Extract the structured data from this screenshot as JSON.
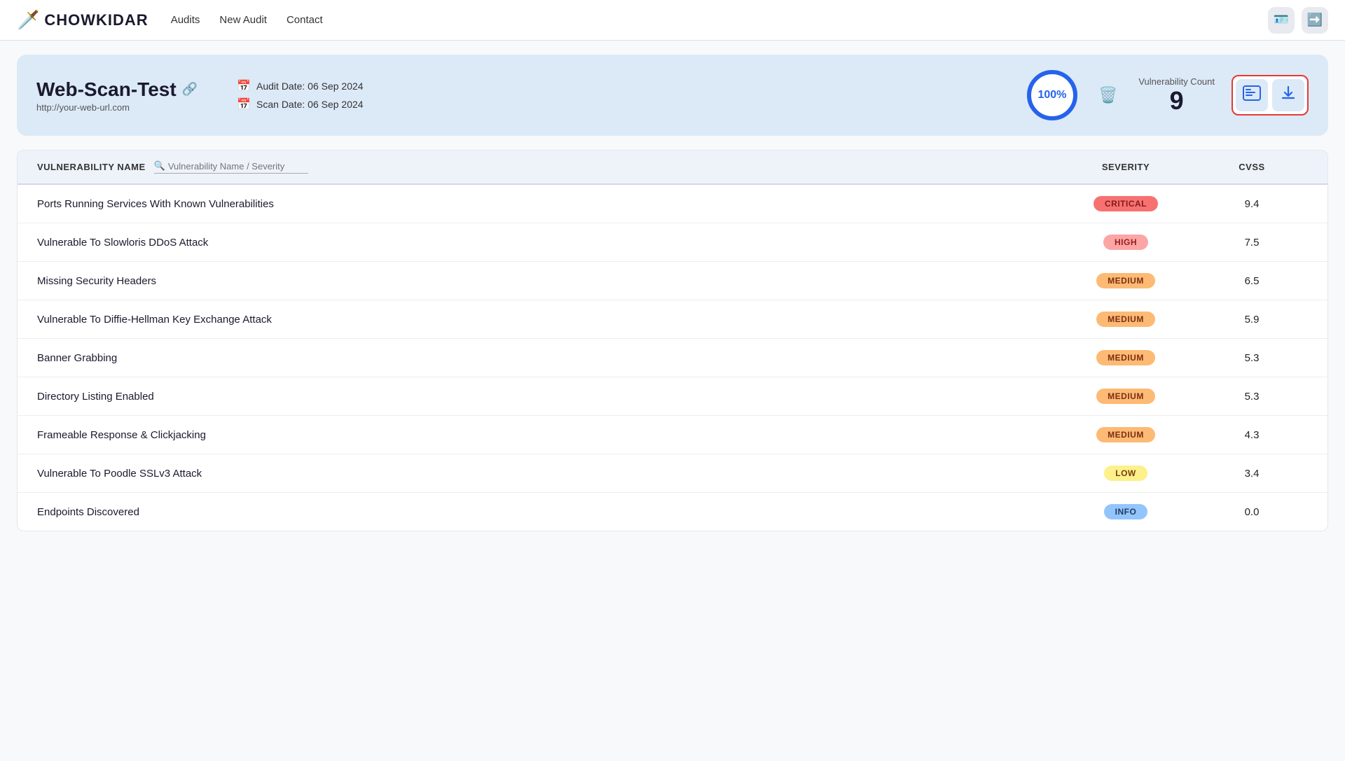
{
  "navbar": {
    "logo_text": "CHOWKIDAR",
    "links": [
      {
        "label": "Audits",
        "id": "audits"
      },
      {
        "label": "New Audit",
        "id": "new-audit"
      },
      {
        "label": "Contact",
        "id": "contact"
      }
    ],
    "icon_buttons": [
      {
        "id": "user-icon-btn",
        "icon": "👤"
      },
      {
        "id": "logout-icon-btn",
        "icon": "🚪"
      }
    ]
  },
  "header": {
    "title": "Web-Scan-Test",
    "url": "http://your-web-url.com",
    "audit_date_label": "Audit Date: 06 Sep 2024",
    "scan_date_label": "Scan Date: 06 Sep 2024",
    "progress": "100%",
    "vuln_count_label": "Vulnerability Count",
    "vuln_count": "9",
    "action_btn_1_icon": "🖥️",
    "action_btn_2_icon": "⬇️"
  },
  "table": {
    "columns": [
      {
        "id": "name",
        "label": "VULNERABILITY NAME"
      },
      {
        "id": "severity",
        "label": "SEVERITY"
      },
      {
        "id": "cvss",
        "label": "CVSS"
      }
    ],
    "search_placeholder": "Vulnerability Name / Severity",
    "rows": [
      {
        "name": "Ports Running Services With Known Vulnerabilities",
        "severity": "CRITICAL",
        "severity_class": "critical",
        "cvss": "9.4"
      },
      {
        "name": "Vulnerable To Slowloris DDoS Attack",
        "severity": "HIGH",
        "severity_class": "high",
        "cvss": "7.5"
      },
      {
        "name": "Missing Security Headers",
        "severity": "MEDIUM",
        "severity_class": "medium",
        "cvss": "6.5"
      },
      {
        "name": "Vulnerable To Diffie-Hellman Key Exchange Attack",
        "severity": "MEDIUM",
        "severity_class": "medium",
        "cvss": "5.9"
      },
      {
        "name": "Banner Grabbing",
        "severity": "MEDIUM",
        "severity_class": "medium",
        "cvss": "5.3"
      },
      {
        "name": "Directory Listing Enabled",
        "severity": "MEDIUM",
        "severity_class": "medium",
        "cvss": "5.3"
      },
      {
        "name": "Frameable Response & Clickjacking",
        "severity": "MEDIUM",
        "severity_class": "medium",
        "cvss": "4.3"
      },
      {
        "name": "Vulnerable To Poodle SSLv3 Attack",
        "severity": "LOW",
        "severity_class": "low",
        "cvss": "3.4"
      },
      {
        "name": "Endpoints Discovered",
        "severity": "INFO",
        "severity_class": "info",
        "cvss": "0.0"
      }
    ]
  }
}
